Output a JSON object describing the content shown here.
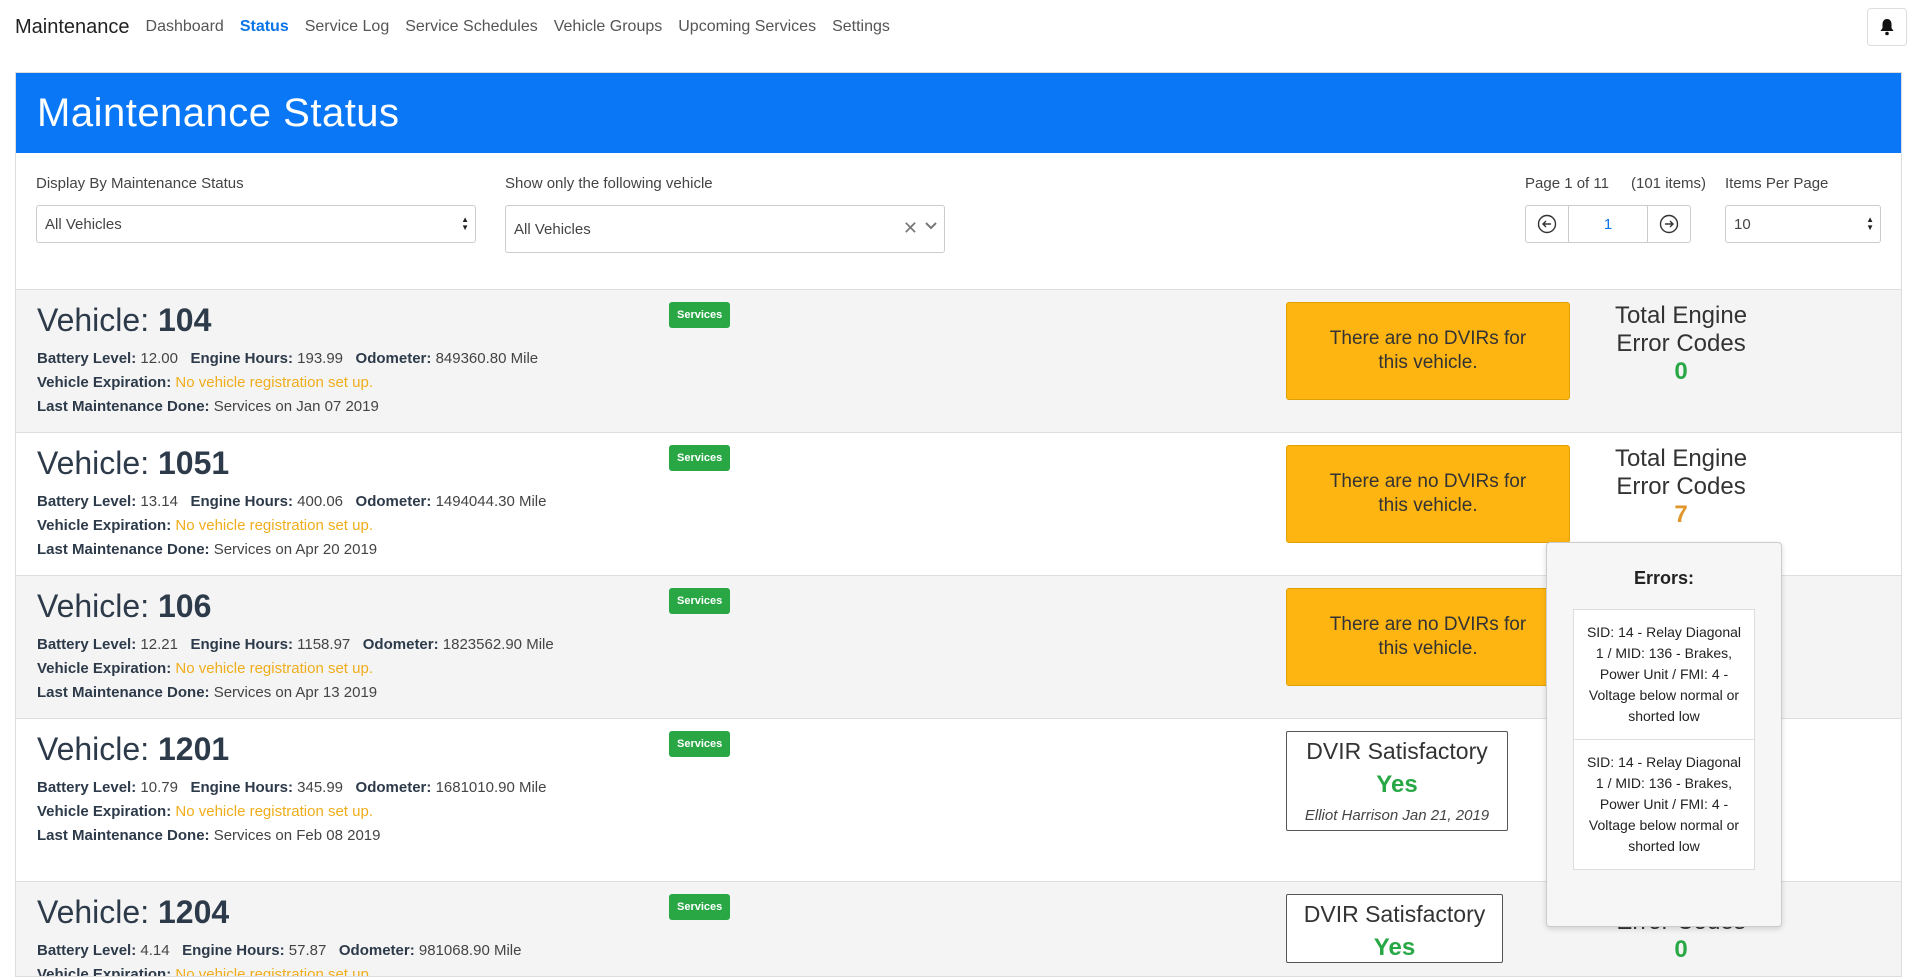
{
  "nav": {
    "brand": "Maintenance",
    "links": [
      "Dashboard",
      "Status",
      "Service Log",
      "Service Schedules",
      "Vehicle Groups",
      "Upcoming Services",
      "Settings"
    ],
    "active": "Status"
  },
  "header": {
    "title": "Maintenance Status"
  },
  "filters": {
    "status_label": "Display By Maintenance Status",
    "status_value": "All Vehicles",
    "vehicle_label": "Show only the following vehicle",
    "vehicle_value": "All Vehicles",
    "page_info": "Page 1 of 11",
    "item_count": "(101 items)",
    "page_number": "1",
    "items_per_page_label": "Items Per Page",
    "items_per_page_value": "10"
  },
  "labels": {
    "vehicle": "Vehicle:",
    "battery": "Battery Level:",
    "engine_hours": "Engine Hours:",
    "odometer": "Odometer:",
    "expiration": "Vehicle Expiration:",
    "last_maintenance": "Last Maintenance Done:",
    "services_badge": "Services",
    "no_dvir": "There are no DVIRs for this vehicle.",
    "dvir_satisfactory": "DVIR Satisfactory",
    "total_engine": "Total Engine",
    "error_codes": "Error Codes"
  },
  "vehicles": [
    {
      "id": "104",
      "battery": "12.00",
      "engine_hours": "193.99",
      "odometer": "849360.80 Mile",
      "expiration": "No vehicle registration set up.",
      "last_maintenance": "Services on Jan 07 2019",
      "errors": "0"
    },
    {
      "id": "1051",
      "battery": "13.14",
      "engine_hours": "400.06",
      "odometer": "1494044.30 Mile",
      "expiration": "No vehicle registration set up.",
      "last_maintenance": "Services on Apr 20 2019",
      "errors": "7"
    },
    {
      "id": "106",
      "battery": "12.21",
      "engine_hours": "1158.97",
      "odometer": "1823562.90 Mile",
      "expiration": "No vehicle registration set up.",
      "last_maintenance": "Services on Apr 13 2019"
    },
    {
      "id": "1201",
      "battery": "10.79",
      "engine_hours": "345.99",
      "odometer": "1681010.90 Mile",
      "expiration": "No vehicle registration set up.",
      "last_maintenance": "Services on Feb 08 2019",
      "dvir_yes": "Yes",
      "dvir_by": "Elliot Harrison Jan 21, 2019"
    },
    {
      "id": "1204",
      "battery": "4.14",
      "engine_hours": "57.87",
      "odometer": "981068.90 Mile",
      "expiration": "No vehicle registration set up.",
      "dvir_yes": "Yes",
      "errors": "0"
    }
  ],
  "popup": {
    "title": "Errors:",
    "items": [
      "SID: 14 - Relay Diagonal 1 / MID: 136 - Brakes, Power Unit / FMI: 4 - Voltage below normal or shorted low",
      "SID: 14 - Relay Diagonal 1 / MID: 136 - Brakes, Power Unit / FMI: 4 - Voltage below normal or shorted low"
    ]
  },
  "colors": {
    "primary": "#0a78f6",
    "warning": "#ffb511",
    "success": "#28a745",
    "error_count": "#e0962a"
  }
}
